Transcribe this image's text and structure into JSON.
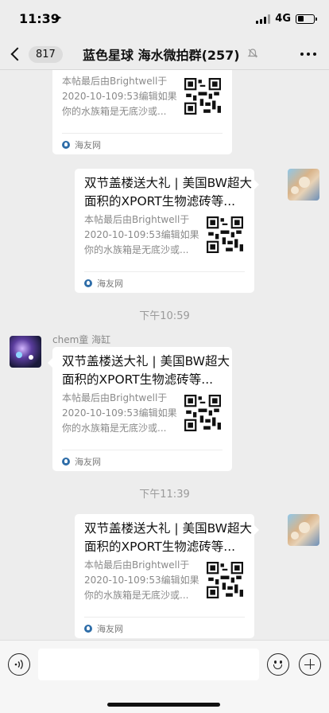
{
  "status_bar": {
    "time": "11:39",
    "network": "4G",
    "battery_level": 0.4
  },
  "nav": {
    "unread_count": "817",
    "title": "蓝色星球 海水微拍群(257)"
  },
  "link_card": {
    "title": "双节盖楼送大礼 | 美国BW超大面积的XPORT生物滤砖等...",
    "description": "本帖最后由Brightwell于2020-10-109:53编辑如果你的水族箱是无底沙或...",
    "source": "海友网"
  },
  "messages": [
    {
      "type": "card",
      "side": "left"
    },
    {
      "type": "card",
      "side": "right",
      "avatar": "user-avatar"
    },
    {
      "type": "time",
      "text": "下午10:59"
    },
    {
      "type": "card",
      "side": "left",
      "sender": "chem童 海缸",
      "avatar": "sender-avatar"
    },
    {
      "type": "time",
      "text": "下午11:39"
    },
    {
      "type": "card",
      "side": "right",
      "avatar": "user-avatar"
    }
  ],
  "input_bar": {
    "placeholder": ""
  },
  "icons": {
    "back": "chevron-left-icon",
    "mute": "bell-off-icon",
    "more": "more-icon",
    "voice": "voice-icon",
    "emoji": "emoji-icon",
    "add": "plus-icon",
    "source": "globe-icon"
  }
}
